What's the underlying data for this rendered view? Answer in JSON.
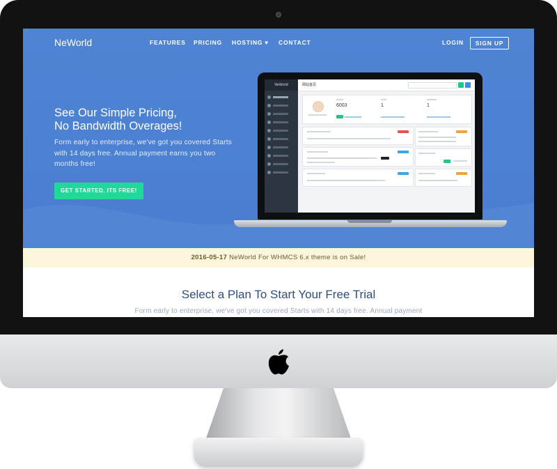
{
  "nav": {
    "logo": "NeWorld",
    "features": "FEATURES",
    "pricing": "PRICING",
    "hosting": "HOSTING ▾",
    "contact": "CONTACT",
    "login": "LOGIN",
    "signup": "SIGN UP"
  },
  "hero": {
    "title_line1": "See Our Simple Pricing,",
    "title_line2": "No Bandwidth Overages!",
    "subtitle": "Form early to enterprise, we've got you covered Starts with 14 days free. Annual payment earns you two months free!",
    "cta": "GET STARTED, ITS FREE!"
  },
  "mockup": {
    "brand": "NeWorld",
    "page_title": "网站首页",
    "stat_1": "6003",
    "stat_2": "1",
    "stat_3": "1"
  },
  "announcement": {
    "date": "2016-05-17",
    "text": "NeWorld For WHMCS 6.x theme is on Sale!"
  },
  "plans": {
    "title": "Select a Plan To Start Your Free Trial",
    "subtitle": "Form early to enterprise, we've got you covered Starts with 14 days free. Annual payment"
  },
  "colors": {
    "hero_blue": "#4f84d3",
    "cta_green": "#1fd99a",
    "announce_bg": "#fcf6dd",
    "plans_title": "#2f4e7a"
  },
  "icons": [
    "apple-logo-icon",
    "camera-icon"
  ]
}
